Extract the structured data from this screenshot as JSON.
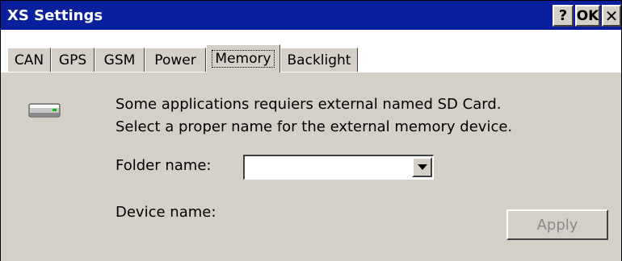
{
  "window": {
    "title": "XS Settings",
    "help_label": "?",
    "ok_label": "OK",
    "close_label": "✕"
  },
  "tabs": [
    {
      "label": "CAN",
      "active": false
    },
    {
      "label": "GPS",
      "active": false
    },
    {
      "label": "GSM",
      "active": false
    },
    {
      "label": "Power",
      "active": false
    },
    {
      "label": "Memory",
      "active": true
    },
    {
      "label": "Backlight",
      "active": false
    }
  ],
  "memory": {
    "description_line1": "Some applications requiers external named SD Card.",
    "description_line2": "Select a proper name for the external memory device.",
    "folder_label": "Folder name:",
    "folder_value": "",
    "device_label": "Device name:",
    "apply_label": "Apply"
  },
  "icons": {
    "drive": "drive-icon",
    "dropdown": "chevron-down-icon"
  }
}
